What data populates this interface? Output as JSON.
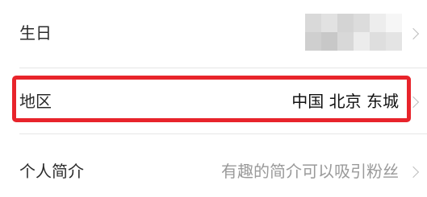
{
  "rows": {
    "birthday": {
      "label": "生日",
      "value_obscured": true
    },
    "region": {
      "label": "地区",
      "value": "中国 北京 东城",
      "highlighted": true
    },
    "bio": {
      "label": "个人简介",
      "placeholder": "有趣的简介可以吸引粉丝"
    }
  },
  "colors": {
    "highlight_border": "#e8242b",
    "label_text": "#2b2b2b",
    "value_text": "#111111",
    "placeholder_text": "#9a9a9a",
    "chevron": "#bdbdbd",
    "divider": "#e6e6e6"
  },
  "icons": {
    "row_arrow": "chevron-right-icon"
  }
}
